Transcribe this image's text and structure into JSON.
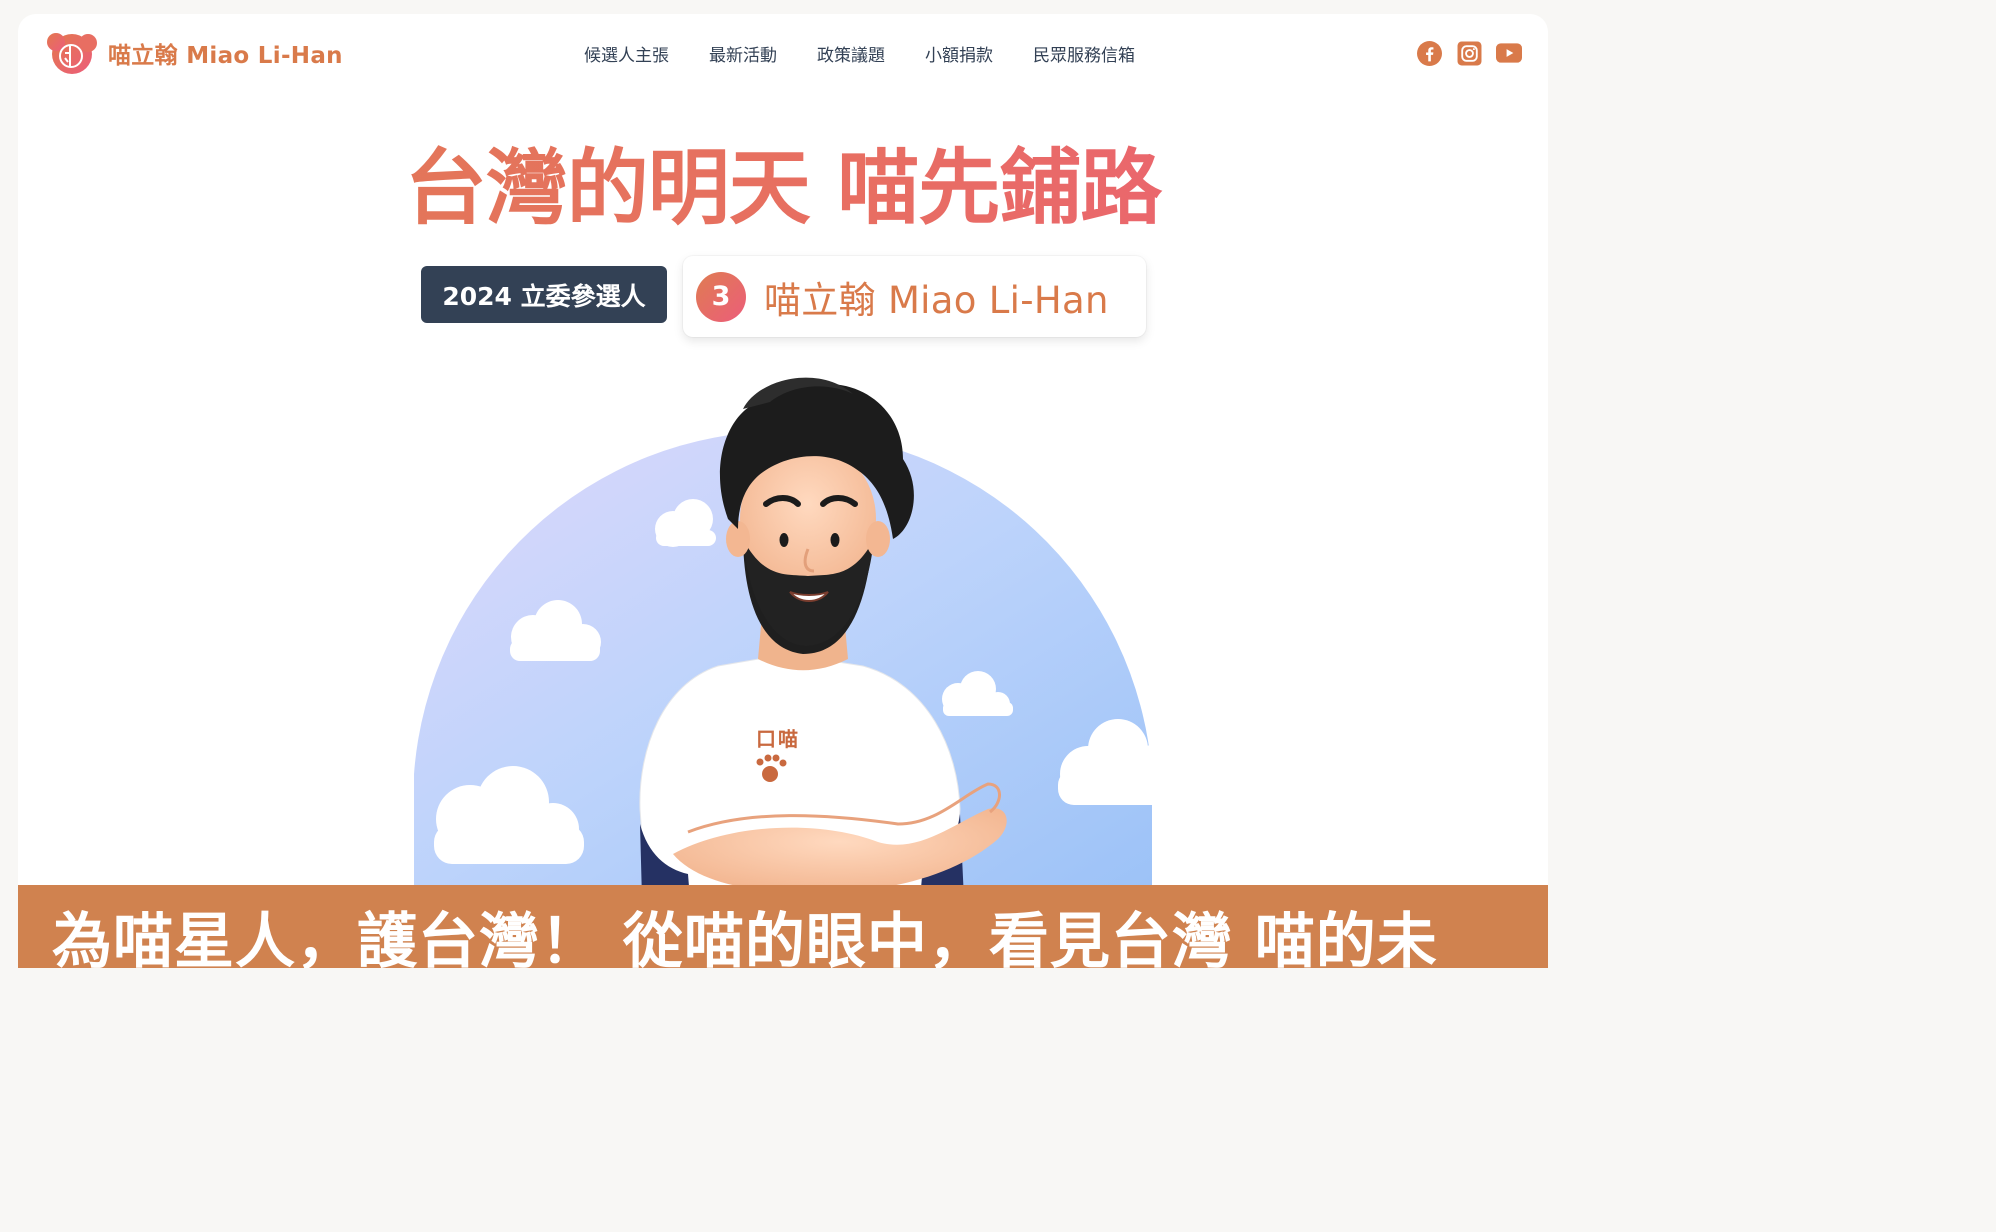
{
  "brand": {
    "name": "喵立翰 Miao Li-Han"
  },
  "nav": {
    "items": [
      {
        "label": "候選人主張"
      },
      {
        "label": "最新活動"
      },
      {
        "label": "政策議題"
      },
      {
        "label": "小額捐款"
      },
      {
        "label": "民眾服務信箱"
      }
    ]
  },
  "social": {
    "icons": [
      "facebook-icon",
      "instagram-icon",
      "youtube-icon"
    ]
  },
  "hero": {
    "headline": "台灣的明天 喵先鋪路",
    "badge": "2024 立委參選人",
    "ballot_number": "3",
    "candidate_name": "喵立翰 Miao Li-Han",
    "shirt_text": "喵"
  },
  "ticker": {
    "text": "為喵星人，護台灣！ 從喵的眼中，看見台灣 喵的未"
  },
  "colors": {
    "accent": "#d97a4a",
    "accent_pink": "#ec5d7a",
    "ticker_bg": "#d0824f",
    "dark_badge": "#334155",
    "sky_blue": "#a9c7f7"
  }
}
